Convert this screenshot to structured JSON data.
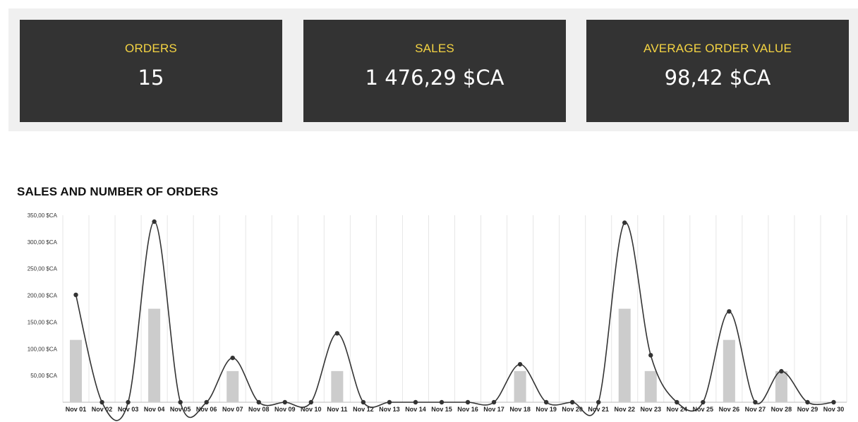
{
  "kpis": [
    {
      "label": "ORDERS",
      "value": "15"
    },
    {
      "label": "SALES",
      "value": "1 476,29 $CA"
    },
    {
      "label": "AVERAGE ORDER VALUE",
      "value": "98,42 $CA"
    }
  ],
  "chart_title": "SALES AND NUMBER OF ORDERS",
  "chart_data": {
    "type": "bar",
    "title": "SALES AND NUMBER OF ORDERS",
    "categories": [
      "Nov 01",
      "Nov 02",
      "Nov 03",
      "Nov 04",
      "Nov 05",
      "Nov 06",
      "Nov 07",
      "Nov 08",
      "Nov 09",
      "Nov 10",
      "Nov 11",
      "Nov 12",
      "Nov 13",
      "Nov 14",
      "Nov 15",
      "Nov 16",
      "Nov 17",
      "Nov 18",
      "Nov 19",
      "Nov 20",
      "Nov 21",
      "Nov 22",
      "Nov 23",
      "Nov 24",
      "Nov 25",
      "Nov 26",
      "Nov 27",
      "Nov 28",
      "Nov 29",
      "Nov 30"
    ],
    "series": [
      {
        "type": "bar",
        "values": [
          2,
          0,
          0,
          3,
          0,
          0,
          1,
          0,
          0,
          0,
          1,
          0,
          0,
          0,
          0,
          0,
          0,
          1,
          0,
          0,
          0,
          3,
          1,
          0,
          0,
          2,
          0,
          1,
          0,
          0
        ]
      },
      {
        "type": "line",
        "values": [
          201,
          0,
          0,
          338,
          0,
          0,
          83,
          0,
          0,
          0,
          129,
          0,
          0,
          0,
          0,
          0,
          0,
          71,
          0,
          0,
          0,
          336,
          88,
          0,
          0,
          170,
          0,
          58,
          0,
          0
        ]
      }
    ],
    "ylim": [
      0,
      350
    ],
    "yticks": [
      "50,00 $CA",
      "100,00 $CA",
      "150,00 $CA",
      "200,00 $CA",
      "250,00 $CA",
      "300,00 $CA",
      "350,00 $CA"
    ],
    "colors": {
      "bar": "#cccccc",
      "line": "#333333",
      "grid": "#e6e6e6"
    },
    "grid": true
  }
}
